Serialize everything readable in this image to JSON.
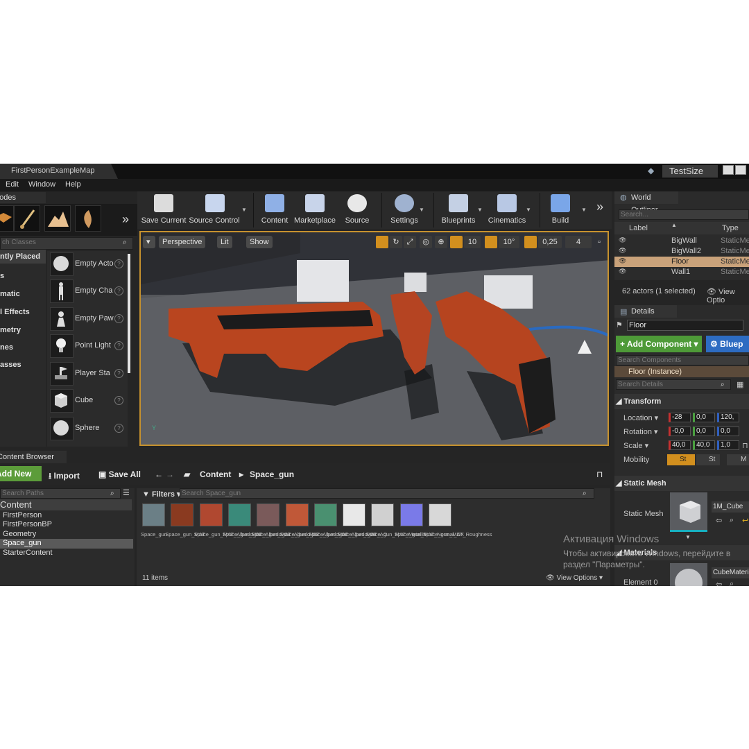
{
  "titlebar": {
    "doc_tab": "FirstPersonExampleMap",
    "project": "TestSize"
  },
  "menu": [
    "Edit",
    "Window",
    "Help"
  ],
  "modes": {
    "tab": "Modes",
    "search_placeholder": "ch Classes",
    "categories": [
      "ntly Placed",
      "s",
      "matic",
      "l Effects",
      "metry",
      "nes",
      "asses"
    ],
    "items": [
      {
        "label": "Empty Acto",
        "icon": "sphere-icon"
      },
      {
        "label": "Empty Cha",
        "icon": "mannequin-icon"
      },
      {
        "label": "Empty Paw",
        "icon": "pawn-icon"
      },
      {
        "label": "Point Light",
        "icon": "bulb-icon"
      },
      {
        "label": "Player Sta",
        "icon": "player-start-icon"
      },
      {
        "label": "Cube",
        "icon": "cube-icon"
      },
      {
        "label": "Sphere",
        "icon": "sphere-icon"
      }
    ]
  },
  "toolbar": {
    "buttons": [
      {
        "label": "Save Current",
        "icon": "save-icon"
      },
      {
        "label": "Source Control",
        "icon": "source-control-icon"
      },
      {
        "label": "Content",
        "icon": "content-icon"
      },
      {
        "label": "Marketplace",
        "icon": "marketplace-icon"
      },
      {
        "label": "Source",
        "icon": "source-icon"
      },
      {
        "label": "Settings",
        "icon": "settings-icon"
      },
      {
        "label": "Blueprints",
        "icon": "blueprints-icon"
      },
      {
        "label": "Cinematics",
        "icon": "cinematics-icon"
      },
      {
        "label": "Build",
        "icon": "build-icon"
      }
    ]
  },
  "viewport": {
    "perspective": "Perspective",
    "lit": "Lit",
    "show": "Show",
    "grid_snap": "10",
    "rot_snap": "10°",
    "scale_snap": "0,25",
    "cam_speed": "4"
  },
  "content_browser": {
    "tab": "Content Browser",
    "add_new": "Add New",
    "import": "Import",
    "save_all": "Save All",
    "path": [
      "Content",
      "Space_gun"
    ],
    "search_paths_placeholder": "Search Paths",
    "tree": [
      "Content",
      "FirstPerson",
      "FirstPersonBP",
      "Geometry",
      "Space_gun",
      "StarterContent"
    ],
    "filters": "Filters",
    "search_placeholder": "Search Space_gun",
    "items_count": "11 items",
    "view_options": "View Options",
    "assets": [
      {
        "name": "Space_gun",
        "color": "#6b7f86"
      },
      {
        "name": "Space_gun_MAT",
        "color": "#8a3a20"
      },
      {
        "name": "Space_gun_MAT_Albedo_01",
        "color": "#b04830"
      },
      {
        "name": "Space_gun_MAT_Albedo_02",
        "color": "#3a8a7a"
      },
      {
        "name": "Space_gun_MAT_Albedo_03",
        "color": "#7a5a5a"
      },
      {
        "name": "Space_gun_MAT_Albedo_04",
        "color": "#c05838"
      },
      {
        "name": "Space_gun_MAT_Albedo_05",
        "color": "#4a9070"
      },
      {
        "name": "Space_gun_MAT_AO",
        "color": "#e8e8e8"
      },
      {
        "name": "Space_gun_MAT_Metallic",
        "color": "#d0d0d0"
      },
      {
        "name": "Space_gun_MAT_Normal_DX",
        "color": "#7a7ae8"
      },
      {
        "name": "Space_gun_MAT_Roughness",
        "color": "#d8d8d8"
      }
    ]
  },
  "world_outliner": {
    "tab": "World Outliner",
    "search_placeholder": "Search...",
    "col_label": "Label",
    "col_type": "Type",
    "rows": [
      {
        "label": "BigWall",
        "type": "StaticMe"
      },
      {
        "label": "BigWall2",
        "type": "StaticMe"
      },
      {
        "label": "Floor",
        "type": "StaticMe"
      },
      {
        "label": "Wall1",
        "type": "StaticMe"
      }
    ],
    "actors": "62 actors (1 selected)",
    "view_options": "View Optio"
  },
  "details": {
    "tab": "Details",
    "name": "Floor",
    "add_component": "+ Add Component",
    "blueprint": "Bluep",
    "search_components": "Search Components",
    "instance": "Floor (Instance)",
    "search_details": "Search Details",
    "transform": "Transform",
    "location_label": "Location",
    "location": [
      "-28",
      "0,0",
      "120,"
    ],
    "rotation_label": "Rotation",
    "rotation": [
      "-0,0",
      "0,0",
      "0,0"
    ],
    "scale_label": "Scale",
    "scale": [
      "40,0",
      "40,0",
      "1,0"
    ],
    "mobility_label": "Mobility",
    "mobility": [
      "St",
      "St",
      "M"
    ],
    "static_mesh_section": "Static Mesh",
    "static_mesh_label": "Static Mesh",
    "static_mesh_value": "1M_Cube",
    "materials_section": "Materials",
    "element0_label": "Element 0",
    "element0_value": "CubeMateria"
  },
  "watermark": {
    "line1": "Активация Windows",
    "line2": "Чтобы активировать Windows, перейдите в",
    "line3": "раздел \"Параметры\"."
  }
}
